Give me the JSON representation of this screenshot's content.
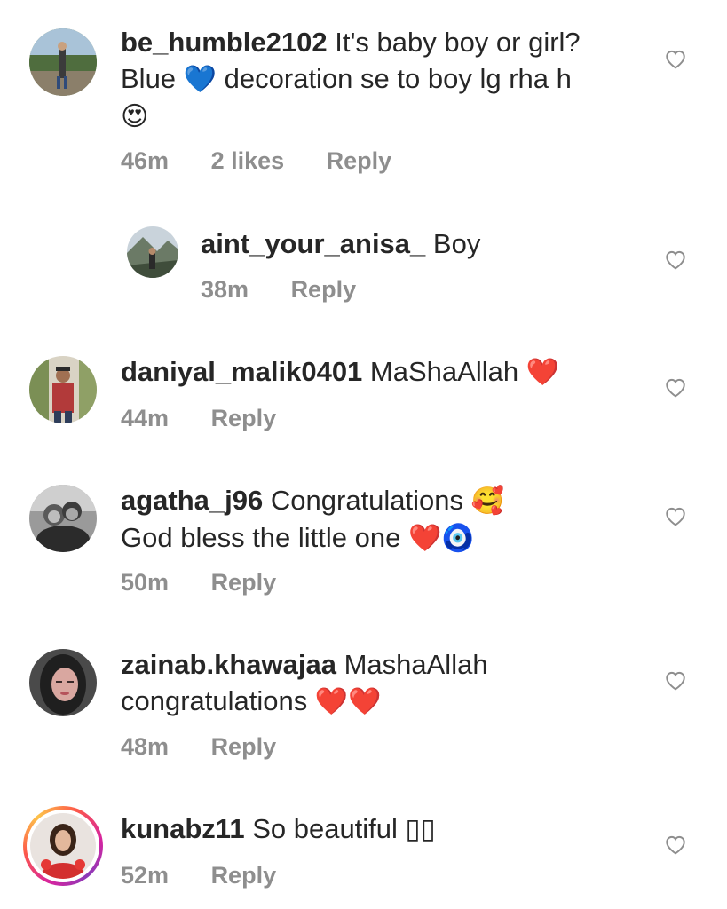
{
  "comments": [
    {
      "username": "be_humble2102",
      "text_line1": "It's baby boy or girl?",
      "text_line2a": "Blue",
      "emoji_blue_heart": "💙",
      "text_line2b": "decoration se to boy lg rha h",
      "emoji_heart_eyes": "😍",
      "time": "46m",
      "likes": "2 likes",
      "reply": "Reply"
    },
    {
      "username": "aint_your_anisa_",
      "text": "Boy",
      "time": "38m",
      "reply": "Reply"
    },
    {
      "username": "daniyal_malik0401",
      "text": "MaShaAllah",
      "emoji": "❤️",
      "time": "44m",
      "reply": "Reply"
    },
    {
      "username": "agatha_j96",
      "text_line1": "Congratulations",
      "emoji_smiling_hearts": "🥰",
      "text_line2": "God bless the little one",
      "emoji_heart": "❤️",
      "emoji_nazar": "🧿",
      "time": "50m",
      "reply": "Reply"
    },
    {
      "username": "zainab.khawajaa",
      "text_line1": "MashaAllah",
      "text_line2": "congratulations",
      "emoji_hearts": "❤️❤️",
      "time": "48m",
      "reply": "Reply"
    },
    {
      "username": "kunabz11",
      "text": "So beautiful",
      "emoji_missing": "▯▯",
      "time": "52m",
      "reply": "Reply"
    }
  ],
  "colors": {
    "text": "#262626",
    "meta": "#8e8e8e",
    "heart_outline": "#8e8e8e",
    "story_ring": "#d6249f"
  },
  "icons": {
    "like": "heart-outline-icon"
  }
}
